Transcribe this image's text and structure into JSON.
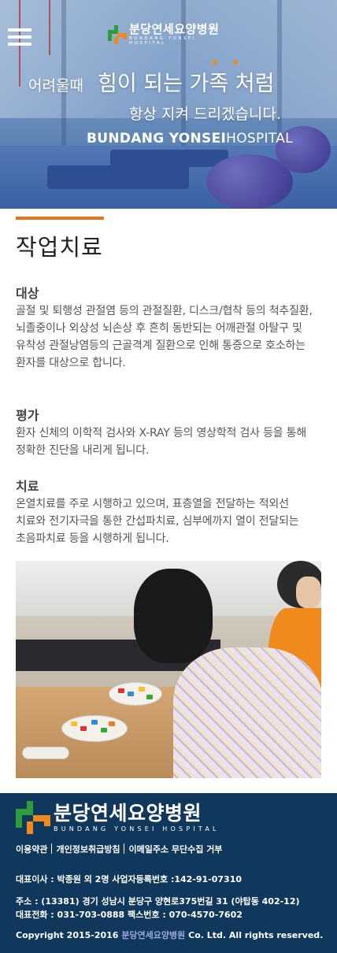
{
  "header": {
    "menu_icon": "hamburger-menu-icon",
    "logo_kr": "분당연세요양병원",
    "logo_en": "BUNDANG YONSEI HOSPITAL"
  },
  "hero": {
    "slogan_small": "어려울때",
    "slogan_large": "힘이 되는 가족 처럼",
    "slogan_line2": "항상 지켜 드리겠습니다.",
    "hospital_bold": "BUNDANG YONSEI",
    "hospital_thin": "HOSPITAL"
  },
  "page": {
    "title": "작업치료",
    "sections": [
      {
        "heading": "대상",
        "body": "골절 및 퇴행성 관절염 등의 관절질환, 디스크/협착 등의 척추질환, 뇌졸중이나 외상성 뇌손상 후 흔히 동반되는 어깨관절 아탈구 및 유착성 관절낭염등의 근골격계 질환으로 인해 통증으로 호소하는 환자를 대상으로 합니다."
      },
      {
        "heading": "평가",
        "body": "환자 신체의 이학적 검사와 X-RAY 등의 영상학적 검사 등을 통해 정확한 진단을 내리게 됩니다."
      },
      {
        "heading": "치료",
        "body": "온열치료를 주로 시행하고 있으며, 표층열을 전달하는 적외선 치료와 전기자극을 통한 간섭파치료, 심부에까지 열이 전달되는 초음파치료 등을 시행하게 됩니다."
      }
    ]
  },
  "footer": {
    "logo_kr": "분당연세요양병원",
    "logo_en": "BUNDANG YONSEI HOSPITAL",
    "links": [
      "이용약관",
      "개인정보취급방침",
      "이메일주소 무단수집 거부"
    ],
    "representative": "대표이사 : 박종원 외 2명 사업자등록번호 :142-91-07310",
    "address": "주소 : (13381) 경기 성남시 분당구 양현로375번길 31 (야탑동 402-12)",
    "phone": "대표전화 : 031-703-0888  팩스번호 : 070-4570-7602",
    "copyright_prefix": "Copyright 2015-2016",
    "copyright_name": "분당연세요양병원",
    "copyright_suffix": "Co. Ltd. All rights reserved."
  },
  "colors": {
    "accent_orange": "#e8731a",
    "footer_bg": "#10385c",
    "logo_green": "#2e9e3a",
    "logo_orange": "#f08a1c"
  }
}
